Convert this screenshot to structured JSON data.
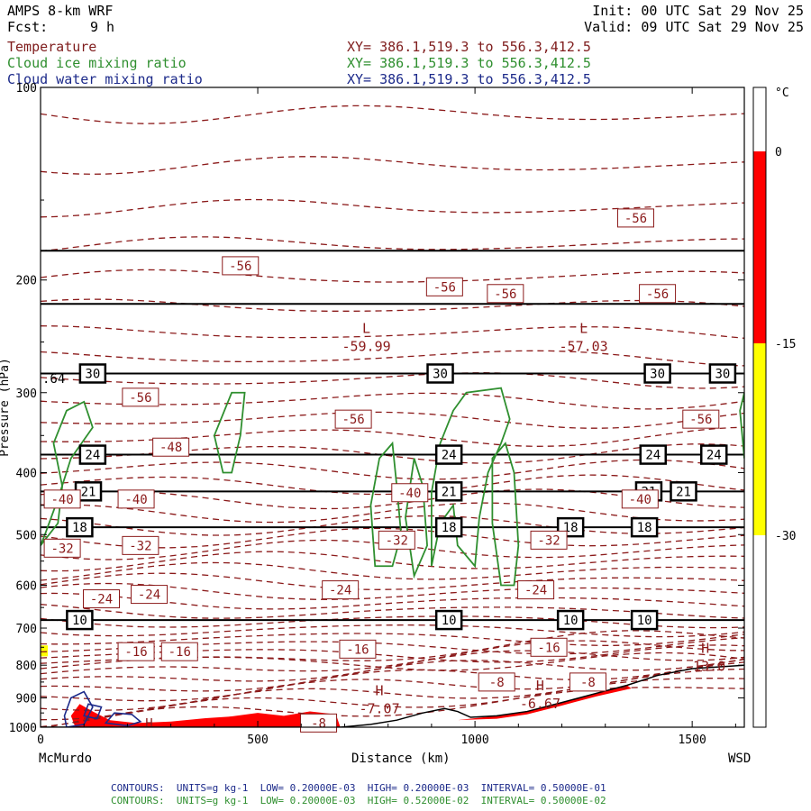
{
  "header": {
    "model": "AMPS 8-km WRF",
    "forecast_label": "Fcst:",
    "forecast_value": "9 h",
    "init": "Init: 00 UTC Sat 29 Nov 25",
    "valid": "Valid: 09 UTC Sat 29 Nov 25",
    "fields": [
      {
        "name": "Temperature",
        "color": "#7f1d1d",
        "xy": "XY= 386.1,519.3 to 556.3,412.5"
      },
      {
        "name": "Cloud ice mixing ratio",
        "color": "#2f8f2f",
        "xy": "XY= 386.1,519.3 to 556.3,412.5"
      },
      {
        "name": "Cloud water mixing ratio",
        "color": "#1c2a8a",
        "xy": "XY= 386.1,519.3 to 556.3,412.5"
      }
    ]
  },
  "footer": [
    {
      "text": "CONTOURS:  UNITS=g kg-1  LOW= 0.20000E-03  HIGH= 0.20000E-03  INTERVAL= 0.50000E-01",
      "color": "#1c2a8a"
    },
    {
      "text": "CONTOURS:  UNITS=g kg-1  LOW= 0.20000E-03  HIGH= 0.52000E-02  INTERVAL= 0.50000E-02",
      "color": "#2f8f2f"
    }
  ],
  "chart_data": {
    "type": "cross-section",
    "xlabel": "Distance (km)",
    "ylabel": "Pressure (hPa)",
    "xlim": [
      0,
      1620
    ],
    "ylim": [
      1000,
      100
    ],
    "y_log": true,
    "x_ticks": [
      0,
      500,
      1000,
      1500
    ],
    "y_ticks": [
      100,
      200,
      300,
      400,
      500,
      600,
      700,
      800,
      900,
      1000
    ],
    "endpoints": {
      "left": "McMurdo",
      "right": "WSD"
    },
    "colorbar": {
      "unit": "°C",
      "labels": [
        "0",
        "-15",
        "-30"
      ],
      "bands": [
        {
          "from": 5,
          "to": 0,
          "color": "#ffffff"
        },
        {
          "from": 0,
          "to": -15,
          "color": "#ff0000"
        },
        {
          "from": -15,
          "to": -30,
          "color": "#ffff00"
        },
        {
          "from": -30,
          "to": -45,
          "color": "#ffffff"
        }
      ]
    },
    "temperature_labels": [
      {
        "x": 1370,
        "p": 160,
        "t": "-56"
      },
      {
        "x": 460,
        "p": 190,
        "t": "-56"
      },
      {
        "x": 930,
        "p": 205,
        "t": "-56"
      },
      {
        "x": 1070,
        "p": 210,
        "t": "-56"
      },
      {
        "x": 1420,
        "p": 210,
        "t": "-56"
      },
      {
        "x": 230,
        "p": 305,
        "t": "-56"
      },
      {
        "x": 720,
        "p": 330,
        "t": "-56"
      },
      {
        "x": 1520,
        "p": 330,
        "t": "-56"
      },
      {
        "x": 300,
        "p": 365,
        "t": "-48"
      },
      {
        "x": 220,
        "p": 440,
        "t": "-40"
      },
      {
        "x": 850,
        "p": 430,
        "t": "-40"
      },
      {
        "x": 1380,
        "p": 440,
        "t": "-40"
      },
      {
        "x": 50,
        "p": 440,
        "t": "-40"
      },
      {
        "x": 50,
        "p": 525,
        "t": "-32"
      },
      {
        "x": 230,
        "p": 520,
        "t": "-32"
      },
      {
        "x": 820,
        "p": 510,
        "t": "-32"
      },
      {
        "x": 1170,
        "p": 510,
        "t": "-32"
      },
      {
        "x": 140,
        "p": 630,
        "t": "-24"
      },
      {
        "x": 250,
        "p": 620,
        "t": "-24"
      },
      {
        "x": 690,
        "p": 610,
        "t": "-24"
      },
      {
        "x": 1140,
        "p": 610,
        "t": "-24"
      },
      {
        "x": 220,
        "p": 762,
        "t": "-16"
      },
      {
        "x": 320,
        "p": 762,
        "t": "-16"
      },
      {
        "x": 730,
        "p": 755,
        "t": "-16"
      },
      {
        "x": 1170,
        "p": 750,
        "t": "-16"
      },
      {
        "x": 1050,
        "p": 850,
        "t": "-8"
      },
      {
        "x": 1260,
        "p": 850,
        "t": "-8"
      },
      {
        "x": 640,
        "p": 985,
        "t": "-8"
      }
    ],
    "extrema": [
      {
        "x": 750,
        "p": 250,
        "kind": "L",
        "value": "-59.99"
      },
      {
        "x": 1250,
        "p": 250,
        "kind": "L",
        "value": "-57.03"
      },
      {
        "x": 1530,
        "p": 790,
        "kind": "H",
        "value": "-13.0"
      },
      {
        "x": 780,
        "p": 920,
        "kind": "H",
        "value": "-7.07"
      },
      {
        "x": 1150,
        "p": 905,
        "kind": "H",
        "value": "-6.67"
      }
    ],
    "ice_labels": [
      {
        "x": 250,
        "p": 985,
        "t": "H"
      }
    ],
    "black_contour_levels": [
      {
        "value": "30",
        "p": 280,
        "boxes": [
          120,
          920,
          1420,
          1570
        ]
      },
      {
        "value": "24",
        "p": 375,
        "boxes": [
          120,
          940,
          1410,
          1550
        ]
      },
      {
        "value": "21",
        "p": 428,
        "boxes": [
          110,
          940,
          1400,
          1480
        ]
      },
      {
        "value": "18",
        "p": 487,
        "boxes": [
          90,
          940,
          1220,
          1390
        ]
      },
      {
        "value": "10",
        "p": 680,
        "boxes": [
          90,
          940,
          1220,
          1390
        ]
      }
    ],
    "black_unlabeled_levels": [
      180,
      218
    ],
    "left_clipped_label": ".64"
  }
}
